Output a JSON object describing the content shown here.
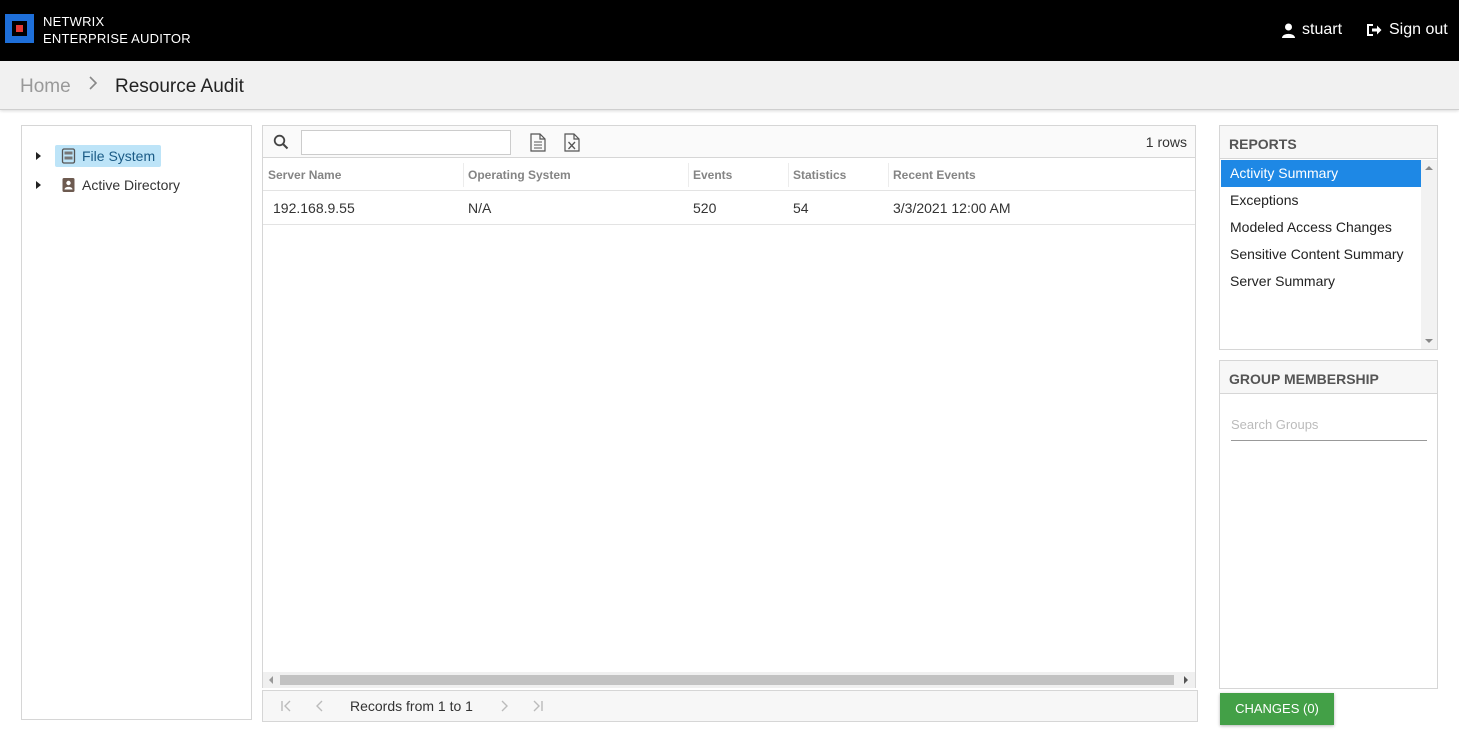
{
  "header": {
    "brand_line1": "NETWRIX",
    "brand_line2": "ENTERPRISE AUDITOR",
    "user_name": "stuart",
    "signout_label": "Sign out"
  },
  "breadcrumb": {
    "home": "Home",
    "current": "Resource Audit"
  },
  "tree": {
    "items": [
      {
        "label": "File System",
        "icon": "server-icon",
        "selected": true
      },
      {
        "label": "Active Directory",
        "icon": "directory-icon",
        "selected": false
      }
    ]
  },
  "grid": {
    "search_value": "",
    "row_count": "1 rows",
    "columns": [
      "Server Name",
      "Operating System",
      "Events",
      "Statistics",
      "Recent Events"
    ],
    "rows": [
      [
        "192.168.9.55",
        "N/A",
        "520",
        "54",
        "3/3/2021 12:00 AM"
      ]
    ]
  },
  "pager": {
    "text": "Records from 1 to 1"
  },
  "reports": {
    "title": "REPORTS",
    "items": [
      "Activity Summary",
      "Exceptions",
      "Modeled Access Changes",
      "Sensitive Content Summary",
      "Server Summary"
    ],
    "active_index": 0
  },
  "groups": {
    "title": "GROUP MEMBERSHIP",
    "search_placeholder": "Search Groups"
  },
  "changes_button": "CHANGES (0)",
  "colors": {
    "topbar": "#000000",
    "logo_blue": "#1e6fd9",
    "logo_red": "#e53935",
    "active_report": "#1e88e5",
    "selected_tree": "#bde4f8",
    "changes_green": "#43a047"
  }
}
